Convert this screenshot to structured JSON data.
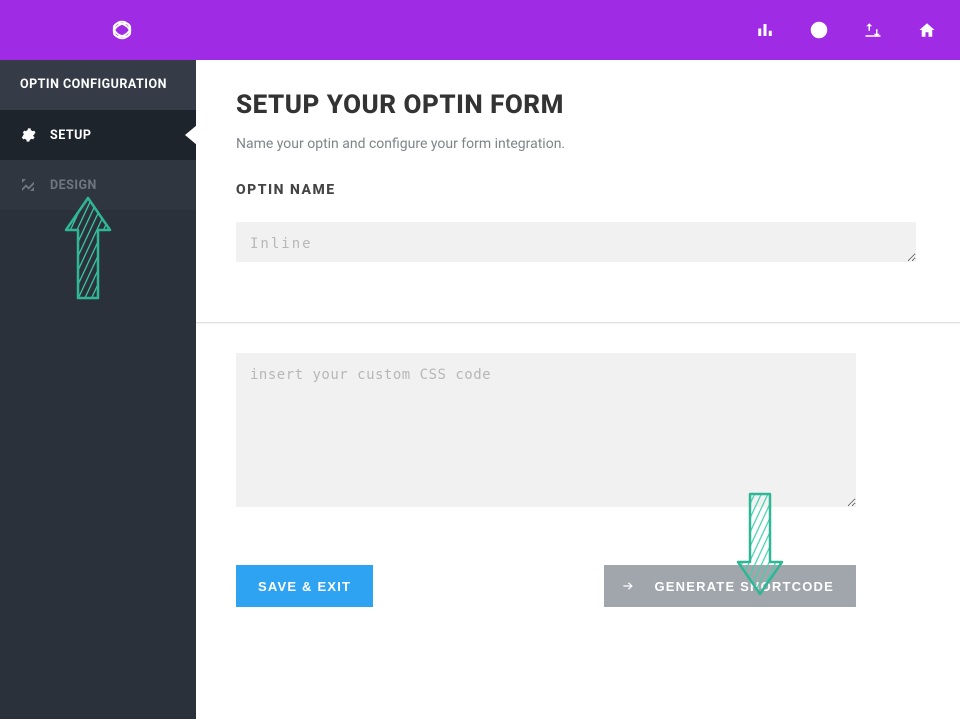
{
  "topbar": {
    "icons": [
      "bar-chart-icon",
      "user-icon",
      "transfer-icon",
      "home-icon"
    ]
  },
  "sidebar": {
    "header": "OPTIN CONFIGURATION",
    "items": [
      {
        "label": "SETUP",
        "icon": "gear-icon",
        "active": true
      },
      {
        "label": "DESIGN",
        "icon": "design-icon",
        "active": false
      }
    ]
  },
  "main": {
    "title": "SETUP YOUR OPTIN FORM",
    "subtitle": "Name your optin and configure your form integration.",
    "optin_label": "OPTIN NAME",
    "optin_value": "Inline",
    "css_placeholder": "insert your custom CSS code",
    "buttons": {
      "save": "SAVE & EXIT",
      "generate": "GENERATE SHORTCODE"
    }
  },
  "colors": {
    "accent_purple": "#A02BE4",
    "accent_blue": "#2EA3F2",
    "arrow_teal": "#3FD1AA"
  }
}
